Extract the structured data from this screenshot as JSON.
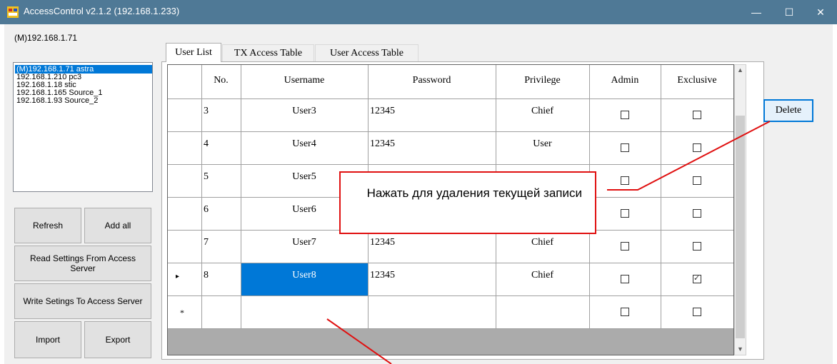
{
  "window": {
    "title": "AccessControl v2.1.2 (192.168.1.233)",
    "minimize": "—",
    "maximize": "☐",
    "close": "✕",
    "icon": "app-icon"
  },
  "left_panel": {
    "current_host": "(M)192.168.1.71",
    "hosts": [
      "(M)192.168.1.71 astra",
      "192.168.1.210 pc3",
      "192.168.1.18 stic",
      "192.168.1.165 Source_1",
      "192.168.1.93 Source_2"
    ],
    "selected_host_index": 0,
    "buttons": {
      "refresh": "Refresh",
      "add_all": "Add all",
      "read_settings": "Read Settings From Access Server",
      "write_settings": "Write Setings To Access Server",
      "import": "Import",
      "export": "Export"
    }
  },
  "tabs": [
    "User List",
    "TX Access Table",
    "User Access Table"
  ],
  "active_tab": "User List",
  "grid": {
    "columns": [
      "No.",
      "Username",
      "Password",
      "Privilege",
      "Admin",
      "Exclusive"
    ],
    "rows": [
      {
        "no": "3",
        "username": "User3",
        "password": "12345",
        "privilege": "Chief",
        "admin": false,
        "exclusive": false
      },
      {
        "no": "4",
        "username": "User4",
        "password": "12345",
        "privilege": "User",
        "admin": false,
        "exclusive": false
      },
      {
        "no": "5",
        "username": "User5",
        "password": "",
        "privilege": "",
        "admin": false,
        "exclusive": false
      },
      {
        "no": "6",
        "username": "User6",
        "password": "",
        "privilege": "",
        "admin": false,
        "exclusive": false
      },
      {
        "no": "7",
        "username": "User7",
        "password": "12345",
        "privilege": "Chief",
        "admin": false,
        "exclusive": false
      },
      {
        "no": "8",
        "username": "User8",
        "password": "12345",
        "privilege": "Chief",
        "admin": false,
        "exclusive": true
      }
    ],
    "current_row_marker": "▸",
    "new_row_marker": "*",
    "selected_cell": {
      "row": 5,
      "column": "Username"
    }
  },
  "delete_button": "Delete",
  "annotation": {
    "text": "Нажать для удаления текущей записи",
    "color": "#e01010"
  },
  "colors": {
    "titlebar": "#4f7996",
    "selection": "#0078d7"
  }
}
